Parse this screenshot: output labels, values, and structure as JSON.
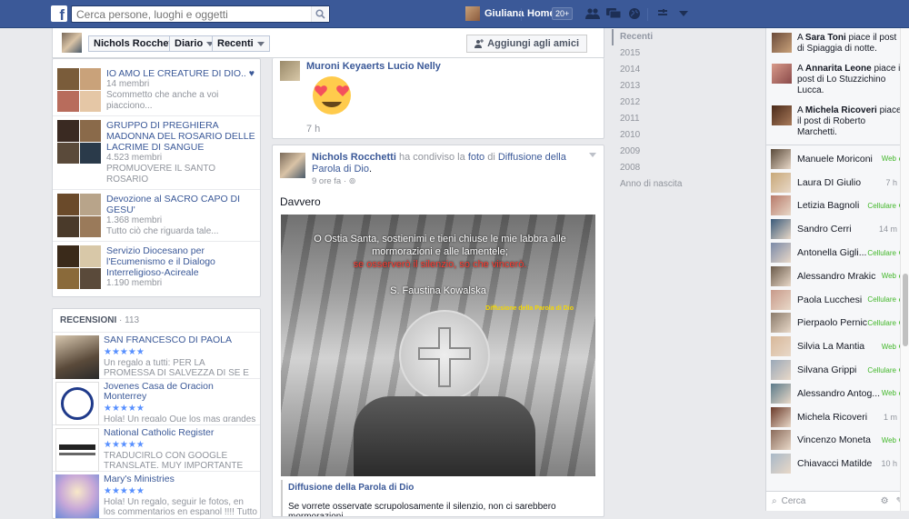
{
  "topbar": {
    "logo": "f",
    "search_placeholder": "Cerca persone, luoghi e oggetti",
    "user_name": "Giuliana",
    "home_label": "Home",
    "home_badge": "20+"
  },
  "cover": {
    "name": "Nichols Rocchetti",
    "diario_label": "Diario",
    "recenti_label": "Recenti",
    "add_friend_label": "Aggiungi agli amici"
  },
  "groups": [
    {
      "name": "IO AMO LE CREATURE DI DIO.. ♥",
      "members": "14 membri",
      "desc": "Scommetto che anche a voi piacciono..."
    },
    {
      "name": "GRUPPO DI PREGHIERA MADONNA DEL ROSARIO DELLE LACRIME DI SANGUE",
      "members": "4.523 membri",
      "desc": "PROMUOVERE IL SANTO ROSARIO"
    },
    {
      "name": "Devozione al SACRO CAPO DI GESU'",
      "members": "1.368 membri",
      "desc": "Tutto ciò che riguarda tale..."
    },
    {
      "name": "Servizio Diocesano per l'Ecumenismo e il Dialogo Interreligioso-Acireale",
      "members": "1.190 membri",
      "desc": ""
    }
  ],
  "reviews": {
    "title": "RECENSIONI",
    "count": "· 113",
    "items": [
      {
        "name": "SAN FRANCESCO DI PAOLA",
        "stars": "★★★★★",
        "text": "Un regalo a tutti: PER LA PROMESSA DI SALVEZZA DI SE E TUTTI I FAMILIARI"
      },
      {
        "name": "Jovenes Casa de Oracion Monterrey",
        "stars": "★★★★★",
        "text": "Hola! Un regalo Que los mas grandes pecadores [pongan] su confianza en Mi"
      },
      {
        "name": "National Catholic Register",
        "stars": "★★★★★",
        "text": "TRADUCIRLO CON GOOGLE TRANSLATE, MUY IMPORTANTE CON"
      },
      {
        "name": "Mary's Ministries",
        "stars": "★★★★★",
        "text": "Hola! Un regalo, seguir le fotos, en los commentarios en espanol !!!! Tutto ha un"
      }
    ]
  },
  "post1": {
    "names": "Muroni Keyaerts Lucio Nelly",
    "time": "7 h"
  },
  "post2": {
    "author": "Nichols Rocchetti",
    "action": "ha condiviso la",
    "foto": "foto",
    "di": "di",
    "page": "Diffusione della Parola di Dio",
    "dot": ".",
    "time": "9 ore fa",
    "message": "Davvero",
    "image_quote_white": "O Ostia Santa, sostienimi e tieni chiuse le mie labbra alle mormorazioni e alle lamentele;",
    "image_quote_red": "se osserverò il silenzio, so che vincerò.",
    "image_signature": "S. Faustina Kowalska",
    "image_watermark": "Diffusione della Parola di Dio",
    "link_title": "Diffusione della Parola di Dio",
    "link_text": "Se vorrete osservate scrupolosamente il silenzio, non ci sarebbero mormorazioni"
  },
  "timeline": [
    "Recenti",
    "2015",
    "2014",
    "2013",
    "2012",
    "2011",
    "2010",
    "2009",
    "2008",
    "Anno di nascita"
  ],
  "ticker": [
    {
      "pre": "A",
      "name": "Sara Toni",
      "text": "piace il post di Spiaggia di notte."
    },
    {
      "pre": "A",
      "name": "Annarita Leone",
      "text": "piace il post di Lo Stuzzichino Lucca."
    },
    {
      "pre": "A",
      "name": "Michela Ricoveri",
      "text": "piace il post di Roberto Marchetti."
    }
  ],
  "chat": [
    {
      "name": "Manuele Moriconi",
      "status": "Web",
      "type": "dot"
    },
    {
      "name": "Laura DI Giulio",
      "status": "7 h",
      "type": "phone"
    },
    {
      "name": "Letizia Bagnoli",
      "status": "Cellulare",
      "type": "dot"
    },
    {
      "name": "Sandro Cerri",
      "status": "14 m",
      "type": "phone"
    },
    {
      "name": "Antonella Gigli...",
      "status": "Cellulare",
      "type": "dot"
    },
    {
      "name": "Alessandro Mrakic",
      "status": "Web",
      "type": "dot"
    },
    {
      "name": "Paola Lucchesi",
      "status": "Cellulare",
      "type": "dot"
    },
    {
      "name": "Pierpaolo Pernici",
      "status": "Cellulare",
      "type": "dot"
    },
    {
      "name": "Silvia La Mantia",
      "status": "Web",
      "type": "dot"
    },
    {
      "name": "Silvana Grippi",
      "status": "Cellulare",
      "type": "dot"
    },
    {
      "name": "Alessandro Antog...",
      "status": "Web",
      "type": "dot"
    },
    {
      "name": "Michela Ricoveri",
      "status": "1 m",
      "type": "phone"
    },
    {
      "name": "Vincenzo Moneta",
      "status": "Web",
      "type": "dot"
    },
    {
      "name": "Chiavacci Matilde",
      "status": "10 h",
      "type": "phone"
    }
  ],
  "chat_search_placeholder": "Cerca"
}
